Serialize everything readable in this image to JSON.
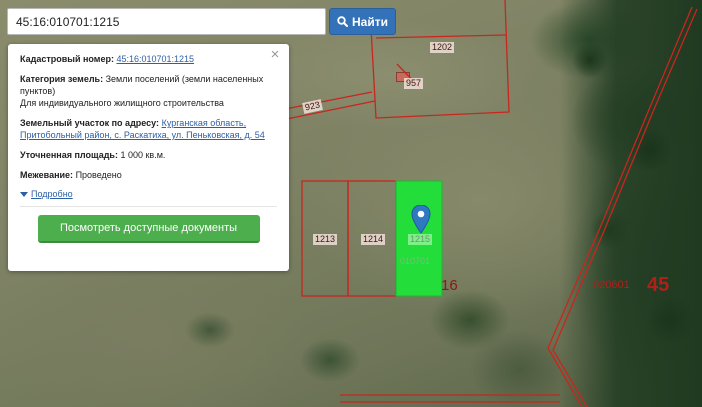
{
  "search": {
    "value": "45:16:010701:1215",
    "button_label": "Найти"
  },
  "popup": {
    "cadastral_label": "Кадастровый номер:",
    "cadastral_value": "45:16:010701:1215",
    "category_label": "Категория земель:",
    "category_value": "Земли поселений (земли населенных пунктов)",
    "usage": "Для индивидуального жилищного строительства",
    "address_label": "Земельный участок по адресу:",
    "address_value": "Курганская область, Притобольный район, с. Раскатиха, ул. Пеньковская, д. 54",
    "area_label": "Уточненная площадь:",
    "area_value": "1 000 кв.м.",
    "survey_label": "Межевание:",
    "survey_value": "Проведено",
    "details_link": "Подробно",
    "docs_button": "Посмотреть доступные документы"
  },
  "map": {
    "parcel_labels": [
      "1202",
      "957",
      "923",
      "1213",
      "1214",
      "1215",
      "010701"
    ],
    "selected_fragment": "16",
    "quarter_label": "020601",
    "district_label": "45"
  },
  "colors": {
    "parcel_border": "#c8261e",
    "selected_fill": "#22dd3a",
    "search_button": "#3372b9",
    "docs_button": "#4cae4c",
    "link": "#2b5fa6",
    "marker": "#2f78c2"
  },
  "icons": {
    "search": "search-icon",
    "close": "close-icon",
    "marker": "map-marker-icon",
    "expand": "triangle-down-icon"
  }
}
